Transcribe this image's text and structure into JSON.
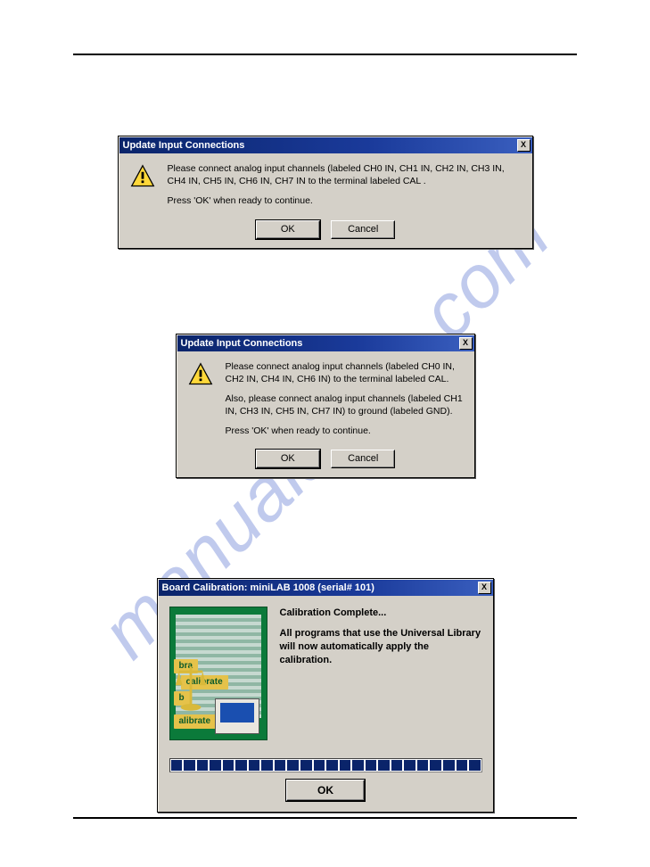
{
  "watermark": "manualshive.com",
  "dialog1": {
    "title": "Update Input Connections",
    "close": "X",
    "text1": "Please connect analog input channels (labeled CH0 IN, CH1 IN, CH2 IN, CH3 IN, CH4 IN, CH5 IN, CH6 IN, CH7 IN to the terminal labeled CAL .",
    "text2": "Press 'OK' when ready to continue.",
    "ok": "OK",
    "cancel": "Cancel"
  },
  "dialog2": {
    "title": "Update Input Connections",
    "close": "X",
    "text1": "Please connect analog input channels (labeled CH0 IN, CH2 IN, CH4 IN, CH6 IN) to the terminal labeled CAL.",
    "text2": "Also, please connect analog input channels (labeled CH1 IN, CH3 IN, CH5 IN, CH7 IN) to ground (labeled GND).",
    "text3": "Press 'OK' when ready to continue.",
    "ok": "OK",
    "cancel": "Cancel"
  },
  "dialog3": {
    "title": "Board Calibration: miniLAB 1008 (serial# 101)",
    "close": "X",
    "img_labels": [
      "bra",
      "calibrate",
      "b",
      "alibrate"
    ],
    "heading": "Calibration Complete...",
    "body": "All programs that use the Universal Library will now automatically apply the calibration.",
    "ok": "OK"
  }
}
